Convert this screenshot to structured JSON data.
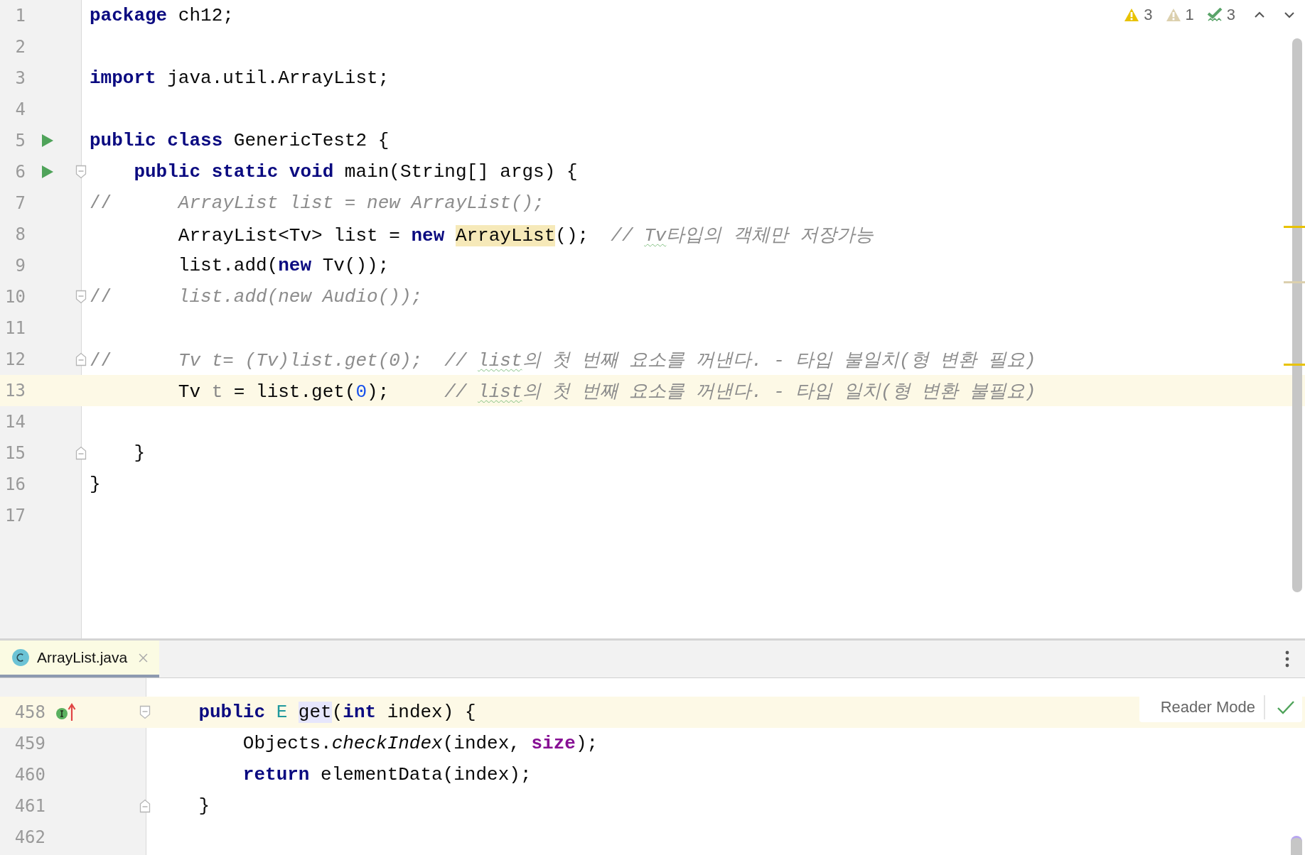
{
  "editor": {
    "inspections": [
      {
        "kind": "warning",
        "count": "3"
      },
      {
        "kind": "weak",
        "count": "1"
      },
      {
        "kind": "typo",
        "count": "3"
      }
    ],
    "lines": [
      {
        "number": "1",
        "current": false,
        "tokens": [
          {
            "t": "package",
            "kind": "kw"
          },
          {
            "t": " ch12;",
            "kind": "plain"
          }
        ]
      },
      {
        "number": "2",
        "current": false
      },
      {
        "number": "3",
        "current": false,
        "tokens": [
          {
            "t": "import",
            "kind": "kw"
          },
          {
            "t": " java.util.ArrayList;",
            "kind": "plain"
          }
        ]
      },
      {
        "number": "4",
        "current": false
      },
      {
        "number": "5",
        "current": false,
        "markers": [
          {
            "kind": "run"
          }
        ],
        "tokens": [
          {
            "t": "public class",
            "kind": "kw"
          },
          {
            "t": " GenericTest2 {",
            "kind": "plain"
          }
        ]
      },
      {
        "number": "6",
        "current": false,
        "markers": [
          {
            "kind": "run"
          },
          {
            "kind": "fold_start"
          }
        ],
        "tokens": [
          {
            "t": "    public static void",
            "kind": "kw"
          },
          {
            "t": " main(String[] args) {",
            "kind": "plain"
          }
        ]
      },
      {
        "number": "7",
        "current": false,
        "tokens": [
          {
            "t": "//",
            "kind": "cmark"
          },
          {
            "t": "      ArrayList list = new ArrayList();",
            "kind": "comment"
          }
        ]
      },
      {
        "number": "8",
        "current": false,
        "tokens": [
          {
            "t": "        ArrayList<Tv> list = ",
            "kind": "plain"
          },
          {
            "t": "new ",
            "kind": "kw"
          },
          {
            "t": "ArrayList",
            "kind": "usage"
          },
          {
            "t": "();  ",
            "kind": "plain"
          },
          {
            "t": "// ",
            "kind": "comment"
          },
          {
            "t": "Tv",
            "kind": "typo"
          },
          {
            "t": "타입의 객체만 저장가능",
            "kind": "comment"
          }
        ]
      },
      {
        "number": "9",
        "current": false,
        "tokens": [
          {
            "t": "        list.add(",
            "kind": "plain"
          },
          {
            "t": "new",
            "kind": "kw"
          },
          {
            "t": " Tv());",
            "kind": "plain"
          }
        ]
      },
      {
        "number": "10",
        "current": false,
        "markers": [
          {
            "kind": "fold_start"
          }
        ],
        "tokens": [
          {
            "t": "//",
            "kind": "cmark"
          },
          {
            "t": "      list.add(new Audio());",
            "kind": "comment"
          }
        ]
      },
      {
        "number": "11",
        "current": false
      },
      {
        "number": "12",
        "current": false,
        "markers": [
          {
            "kind": "fold_end"
          }
        ],
        "tokens": [
          {
            "t": "//",
            "kind": "cmark"
          },
          {
            "t": "      Tv t= (Tv)list.get(0);  // ",
            "kind": "comment"
          },
          {
            "t": "list",
            "kind": "typo"
          },
          {
            "t": "의 첫 번째 요소를 꺼낸다. - 타입 불일치(형 변환 필요)",
            "kind": "comment"
          }
        ]
      },
      {
        "number": "13",
        "current": true,
        "tokens": [
          {
            "t": "        Tv ",
            "kind": "plain"
          },
          {
            "t": "t",
            "kind": "unused"
          },
          {
            "t": " = list.get(",
            "kind": "plain"
          },
          {
            "t": "0",
            "kind": "num"
          },
          {
            "t": ");     ",
            "kind": "plain"
          },
          {
            "t": "// ",
            "kind": "comment"
          },
          {
            "t": "list",
            "kind": "typo"
          },
          {
            "t": "의 첫 번째 요소를 꺼낸다. - 타입 일치(형 변환 불필요)",
            "kind": "comment"
          }
        ]
      },
      {
        "number": "14",
        "current": false
      },
      {
        "number": "15",
        "current": false,
        "markers": [
          {
            "kind": "fold_end"
          }
        ],
        "tokens": [
          {
            "t": "    }",
            "kind": "plain"
          }
        ]
      },
      {
        "number": "16",
        "current": false,
        "tokens": [
          {
            "t": "}",
            "kind": "plain"
          }
        ]
      },
      {
        "number": "17",
        "current": false
      }
    ]
  },
  "preview": {
    "tabs": [
      {
        "label": "ArrayList.java",
        "selected": true
      }
    ],
    "reader_mode": "Reader Mode",
    "lines": [
      {
        "number": "458",
        "current": true,
        "markers": [
          {
            "kind": "impl"
          },
          {
            "kind": "fold_start"
          }
        ],
        "tokens": [
          {
            "t": "    public ",
            "kind": "kw"
          },
          {
            "t": "E ",
            "kind": "tparam"
          },
          {
            "t": "get",
            "kind": "read"
          },
          {
            "t": "(",
            "kind": "plain"
          },
          {
            "t": "int",
            "kind": "kw"
          },
          {
            "t": " index) {",
            "kind": "plain"
          }
        ]
      },
      {
        "number": "459",
        "current": false,
        "tokens": [
          {
            "t": "        Objects.",
            "kind": "plain"
          },
          {
            "t": "checkIndex",
            "kind": "static"
          },
          {
            "t": "(index, ",
            "kind": "plain"
          },
          {
            "t": "size",
            "kind": "field"
          },
          {
            "t": ");",
            "kind": "plain"
          }
        ]
      },
      {
        "number": "460",
        "current": false,
        "tokens": [
          {
            "t": "        return",
            "kind": "kw"
          },
          {
            "t": " elementData(index);",
            "kind": "plain"
          }
        ]
      },
      {
        "number": "461",
        "current": false,
        "markers": [
          {
            "kind": "fold_end"
          }
        ],
        "tokens": [
          {
            "t": "    }",
            "kind": "plain"
          }
        ]
      },
      {
        "number": "462",
        "current": false
      }
    ]
  }
}
